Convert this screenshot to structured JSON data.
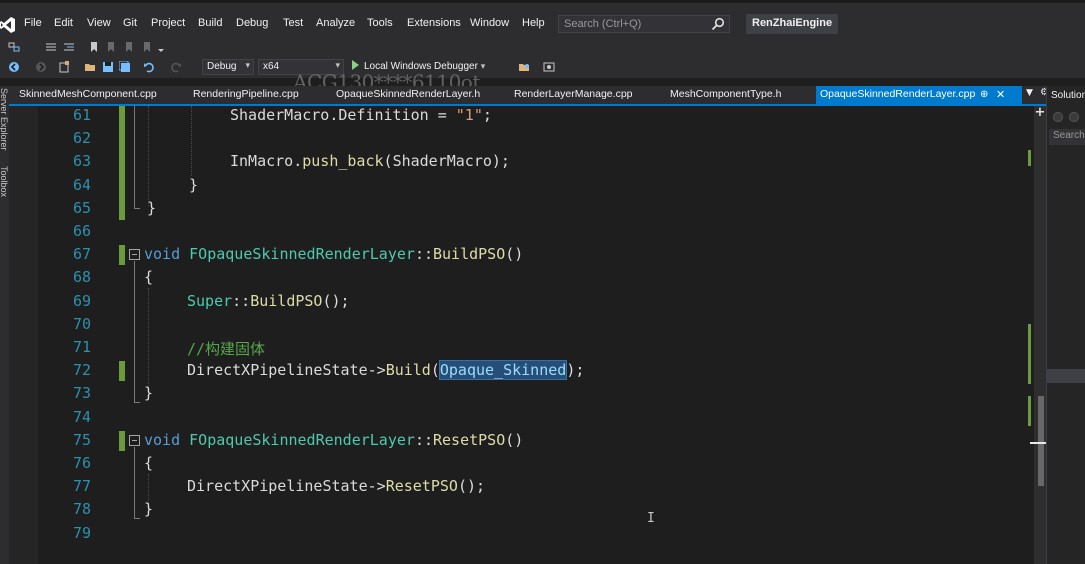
{
  "menubar": {
    "items": [
      "File",
      "Edit",
      "View",
      "Git",
      "Project",
      "Build",
      "Debug",
      "Test",
      "Analyze",
      "Tools",
      "Extensions",
      "Window",
      "Help"
    ],
    "search_placeholder": "Search (Ctrl+Q)",
    "solution_name": "RenZhaiEngine"
  },
  "toolbar": {
    "configuration": "Debug",
    "platform": "x64",
    "debugger_label": "Local Windows Debugger",
    "watermark": "ACG130****6110ot"
  },
  "side_tabs": {
    "server_explorer": "Server Explorer",
    "toolbox": "Toolbox"
  },
  "tabs": {
    "items": [
      "SkinnedMeshComponent.cpp",
      "RenderingPipeline.cpp",
      "OpaqueSkinnedRenderLayer.h",
      "RenderLayerManage.cpp",
      "MeshComponentType.h"
    ],
    "active": "OpaqueSkinnedRenderLayer.cpp"
  },
  "editor": {
    "line_numbers": [
      "61",
      "62",
      "63",
      "64",
      "65",
      "66",
      "67",
      "68",
      "69",
      "70",
      "71",
      "72",
      "73",
      "74",
      "75",
      "76",
      "77",
      "78",
      "79"
    ],
    "lines": {
      "l61_obj": "ShaderMacro",
      "l61_field": "Definition",
      "l61_str": "\"1\"",
      "l63_obj": "InMacro",
      "l63_fn": "push_back",
      "l63_arg": "ShaderMacro",
      "l67_kw": "void",
      "l67_cls": "FOpaqueSkinnedRenderLayer",
      "l67_fn": "BuildPSO",
      "l69_cls": "Super",
      "l69_fn": "BuildPSO",
      "l71_comment": "//构建固体",
      "l72_obj": "DirectXPipelineState",
      "l72_fn": "Build",
      "l72_arg": "Opaque_Skinned",
      "l75_kw": "void",
      "l75_cls": "FOpaqueSkinnedRenderLayer",
      "l75_fn": "ResetPSO",
      "l77_obj": "DirectXPipelineState",
      "l77_fn": "ResetPSO"
    }
  },
  "solution_panel": {
    "title": "Solution",
    "search_placeholder": "Search"
  },
  "colors": {
    "accent": "#007acc",
    "keyword": "#569cd6",
    "class": "#4ec9b0",
    "function": "#dcdcaa",
    "string": "#d69d85",
    "comment": "#57a64a",
    "line_number": "#2b91af",
    "change_bar": "#6a9c3f"
  }
}
